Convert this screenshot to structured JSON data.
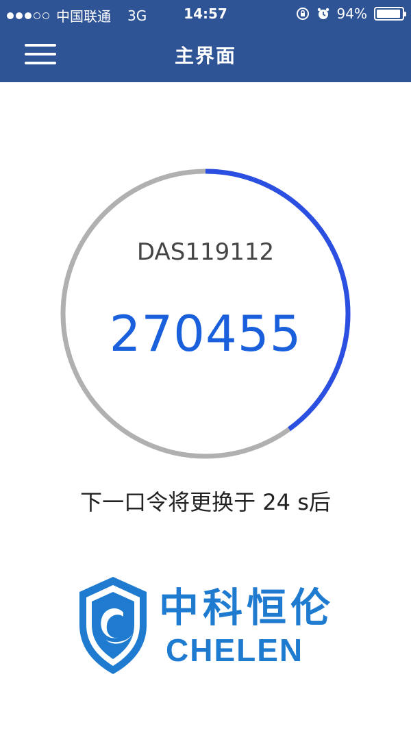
{
  "status_bar": {
    "carrier": "中国联通",
    "network": "3G",
    "time": "14:57",
    "battery": "94%",
    "battery_level": 0.94,
    "signal_strength": 3,
    "icons": [
      "signal-dots-icon",
      "rotation-lock-icon",
      "alarm-icon",
      "battery-icon"
    ]
  },
  "navbar": {
    "title": "主界面",
    "menu_icon": "hamburger-menu-icon"
  },
  "token": {
    "id": "DAS119112",
    "code": "270455",
    "countdown_text": "下一口令将更换于 24 s后",
    "progress_fraction": 0.4
  },
  "logo": {
    "text_cn": "中科恒伦",
    "text_en": "CHELEN"
  },
  "colors": {
    "header": "#2f5496",
    "ring_active": "#2b4fe0",
    "ring_track": "#b0b0b0",
    "code": "#1a5fdc",
    "logo": "#1e7bd0"
  }
}
